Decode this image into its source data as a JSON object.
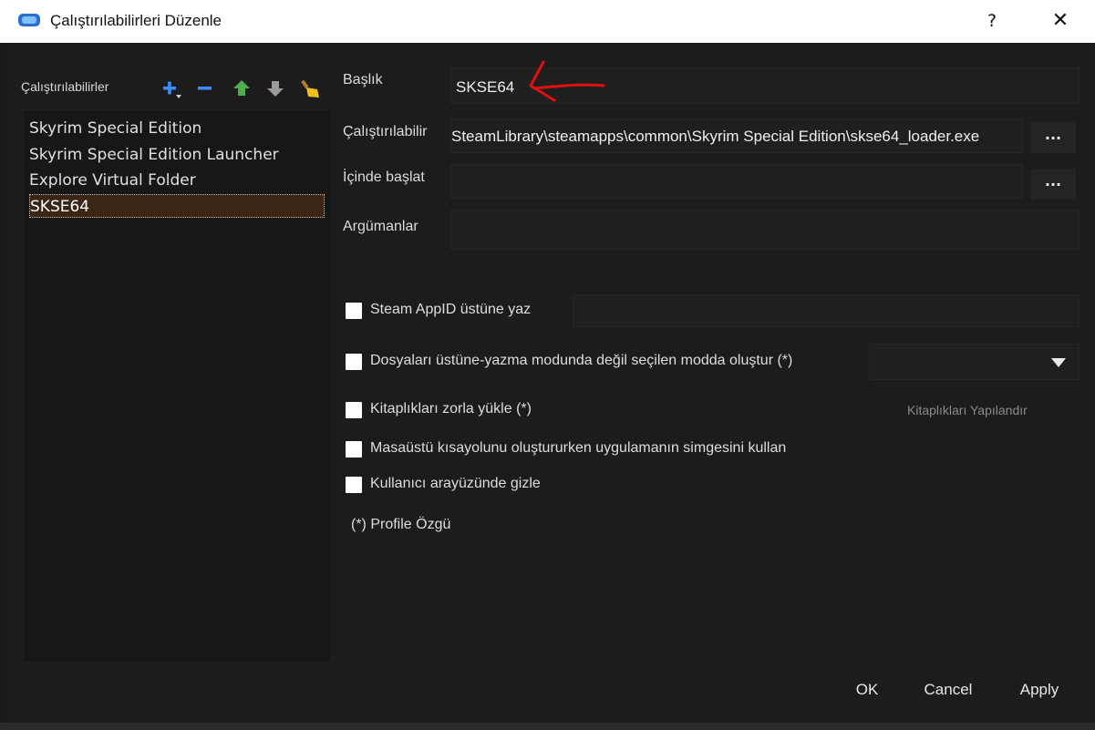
{
  "window": {
    "title": "Çalıştırılabilirleri Düzenle",
    "help": "?",
    "close": "✕"
  },
  "sidebar": {
    "label": "Çalıştırılabilirler",
    "items": [
      {
        "label": "Skyrim Special Edition",
        "selected": false
      },
      {
        "label": "Skyrim Special Edition Launcher",
        "selected": false
      },
      {
        "label": "Explore Virtual Folder",
        "selected": false
      },
      {
        "label": "SKSE64",
        "selected": true
      }
    ],
    "toolbar_icons": [
      "add-icon",
      "remove-icon",
      "move-up-icon",
      "move-down-icon",
      "clean-icon"
    ]
  },
  "form": {
    "title_label": "Başlık",
    "title_value": "SKSE64",
    "binary_label": "Çalıştırılabilir",
    "binary_value": "SteamLibrary\\steamapps\\common\\Skyrim Special Edition\\skse64_loader.exe",
    "workdir_label": "İçinde başlat",
    "workdir_value": "",
    "args_label": "Argümanlar",
    "args_value": "",
    "browse_label": "..."
  },
  "options": {
    "steam_appid_label": "Steam AppID üstüne yaz",
    "steam_appid_value": "",
    "create_files_label": "Dosyaları üstüne-yazma modunda değil seçilen modda oluştur (*)",
    "create_files_value": "",
    "force_libs_label": "Kitaplıkları zorla yükle (*)",
    "configure_libs_label": "Kitaplıkları Yapılandır",
    "use_icon_label": "Masaüstü kısayolunu oluştururken uygulamanın simgesini kullan",
    "hide_ui_label": "Kullanıcı arayüzünde gizle",
    "profile_note": "(*) Profile Özgü"
  },
  "buttons": {
    "ok": "OK",
    "cancel": "Cancel",
    "apply": "Apply"
  },
  "colors": {
    "background": "#1c1c1c",
    "selection": "#3b2515",
    "annotation_arrow": "#e01010",
    "add_icon": "#3a8cff",
    "arrow_icons": "#4caf50"
  }
}
